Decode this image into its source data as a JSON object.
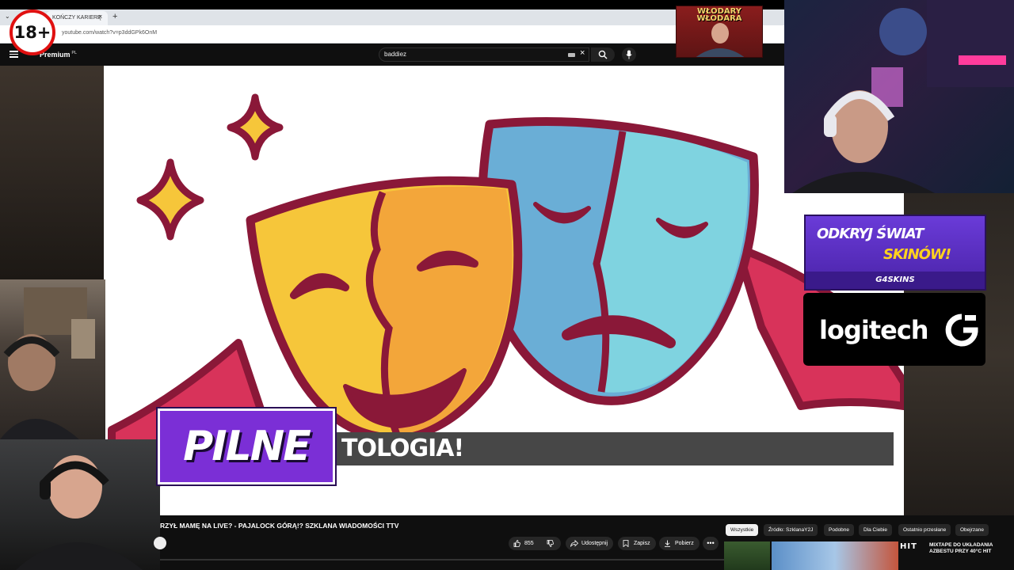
{
  "age_badge": {
    "label": "18+"
  },
  "browser": {
    "tab_label": "KOŃCZY KARIERĘ",
    "tab_close": "×",
    "tab_new": "+",
    "url": "youtube.com/watch?v=p3ddGPk6OnM"
  },
  "youtube_header": {
    "brand": "Premium",
    "region": "PL",
    "search_value": "baddiez",
    "clear": "×"
  },
  "poster": {
    "title_line1": "WŁODARY",
    "title_line2": "WŁODARA"
  },
  "overlay": {
    "badge": "PILNE",
    "ticker": "TOLOGIA!"
  },
  "sponsors": {
    "g4_line1": "ODKRYJ ŚWIAT",
    "g4_line2": "SKINÓW!",
    "g4_brand": "G4SKINS",
    "logitech": "logitech"
  },
  "video_info": {
    "title": "RZYŁ MAMĘ NA LIVE? - PAJALOCK GÓRĄ!? SZKLANA WIADOMOŚCI TTV",
    "likes": "855",
    "share": "Udostępnij",
    "save": "Zapisz",
    "download": "Pobierz",
    "more": "•••"
  },
  "chips": {
    "items": [
      "Wszystkie",
      "Źródło: SzklanaY2J",
      "Podobne",
      "Dla Ciebie",
      "Ostatnio przesłane",
      "Obejrzane"
    ]
  },
  "recommendation": {
    "brand": "HIT",
    "title": "MIXTAPE DO UKŁADANIA AZBESTU PRZY 40°C",
    "brand2": "HIT"
  },
  "colors": {
    "pilne_purple": "#7b2fd6",
    "age_red": "#e01010",
    "mask_yellow": "#f6c63a",
    "mask_orange": "#f3a63a",
    "mask_blue": "#6aaed6",
    "mask_cyan": "#7fd3e0",
    "mask_outline": "#8a1838",
    "ribbon_red": "#d8335a",
    "star_yellow": "#f6c63a"
  }
}
